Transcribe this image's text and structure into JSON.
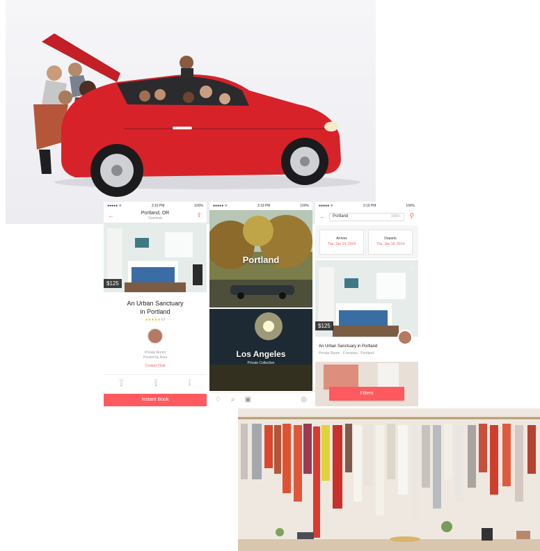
{
  "phone_listing": {
    "status_time": "3:19 PM",
    "status_battery": "100%",
    "city": "Portland, OR",
    "subtitle": "Overlook",
    "price": "$125",
    "title_line1": "An Urban Sanctuary",
    "title_line2": "in Portland",
    "stars": "★★★★★",
    "review_count": "67",
    "room_type": "Private Room",
    "hosted_by": "Hosted by Aura",
    "contact_host": "Contact Host",
    "amenities": [
      "2",
      "1",
      "1"
    ],
    "instant_book": "Instant Book"
  },
  "phone_explore": {
    "status_time": "3:19 PM",
    "status_battery": "100%",
    "city_1": "Portland",
    "city_2": "Los Angeles",
    "city_2_sub": "Private Collection"
  },
  "phone_search": {
    "status_time": "3:19 PM",
    "status_battery": "100%",
    "search_value": "Portland",
    "guests": "1000+",
    "arrives_label": "Arrives",
    "arrives_value": "Tue, Jan 14, 2014",
    "departs_label": "Departs",
    "departs_value": "Thu, Jan 16, 2014",
    "price": "$125",
    "listing_title": "An Urban Sanctuary in Portland",
    "listing_meta": "Private Room · 6 reviews · Portland",
    "filters": "Filters"
  },
  "colors": {
    "accent": "#ff5a5f",
    "car_red": "#d8222a"
  }
}
